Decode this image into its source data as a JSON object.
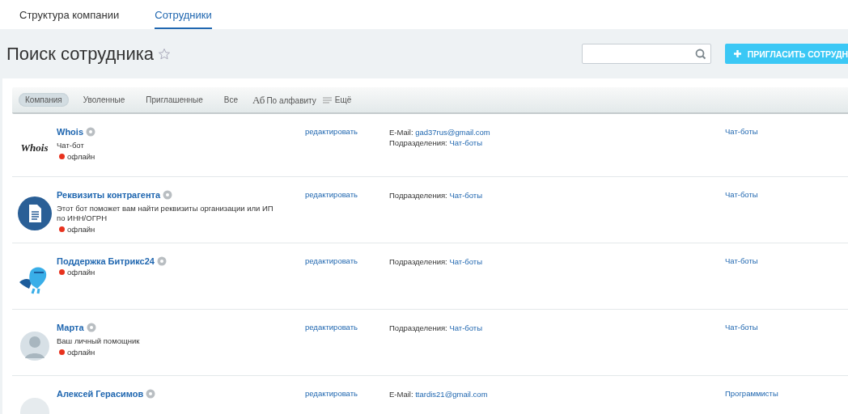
{
  "tabs": [
    {
      "label": "Структура компании",
      "selected": false
    },
    {
      "label": "Сотрудники",
      "selected": true
    }
  ],
  "header": {
    "title": "Поиск сотрудника",
    "favorite": false,
    "invite_button": "ПРИГЛАСИТЬ СОТРУДН"
  },
  "filters": [
    {
      "kind": "pill",
      "label": "Компания",
      "selected": true
    },
    {
      "kind": "pill",
      "label": "Уволенные",
      "selected": false
    },
    {
      "kind": "pill",
      "label": "Приглашенные",
      "selected": false
    },
    {
      "kind": "pill",
      "label": "Все",
      "selected": false
    },
    {
      "kind": "sort",
      "icon_text": "Аб",
      "label": "По алфавиту"
    },
    {
      "kind": "more",
      "label": "Ещё"
    }
  ],
  "employees": [
    {
      "avatar": {
        "kind": "text",
        "text": "Whois"
      },
      "name": "Whois",
      "description": [
        "Чат-бот"
      ],
      "status": {
        "label": "офлайн",
        "color": "#e8321e"
      },
      "edit": "редактировать",
      "contacts": [
        {
          "label": "E-Mail:",
          "value": "gad37rus@gmail.com"
        },
        {
          "label": "Подразделения:",
          "value": "Чат-боты"
        }
      ],
      "department": "Чат-боты"
    },
    {
      "avatar": {
        "kind": "document"
      },
      "name": "Реквизиты контрагента",
      "description": [
        "Этот бот поможет вам найти реквизиты организации или ИП",
        "по ИНН/ОГРН"
      ],
      "status": {
        "label": "офлайн",
        "color": "#e8321e"
      },
      "edit": "редактировать",
      "contacts": [
        {
          "label": "Подразделения:",
          "value": "Чат-боты"
        }
      ],
      "department": "Чат-боты"
    },
    {
      "avatar": {
        "kind": "mascot"
      },
      "name": "Поддержка Битрикс24",
      "status": {
        "label": "офлайн",
        "color": "#e8321e"
      },
      "edit": "редактировать",
      "contacts": [
        {
          "label": "Подразделения:",
          "value": "Чат-боты"
        }
      ],
      "department": "Чат-боты"
    },
    {
      "avatar": {
        "kind": "person"
      },
      "name": "Марта",
      "description": [
        "Ваш личный помощник"
      ],
      "status": {
        "label": "офлайн",
        "color": "#e8321e"
      },
      "edit": "редактировать",
      "contacts": [
        {
          "label": "Подразделения:",
          "value": "Чат-боты"
        }
      ],
      "department": "Чат-боты"
    },
    {
      "avatar": {
        "kind": "small"
      },
      "name": "Алексей Герасимов",
      "edit": "редактировать",
      "contacts": [
        {
          "label": "E-Mail:",
          "value": "ttardis21@gmail.com"
        }
      ],
      "department": "Программисты"
    }
  ]
}
